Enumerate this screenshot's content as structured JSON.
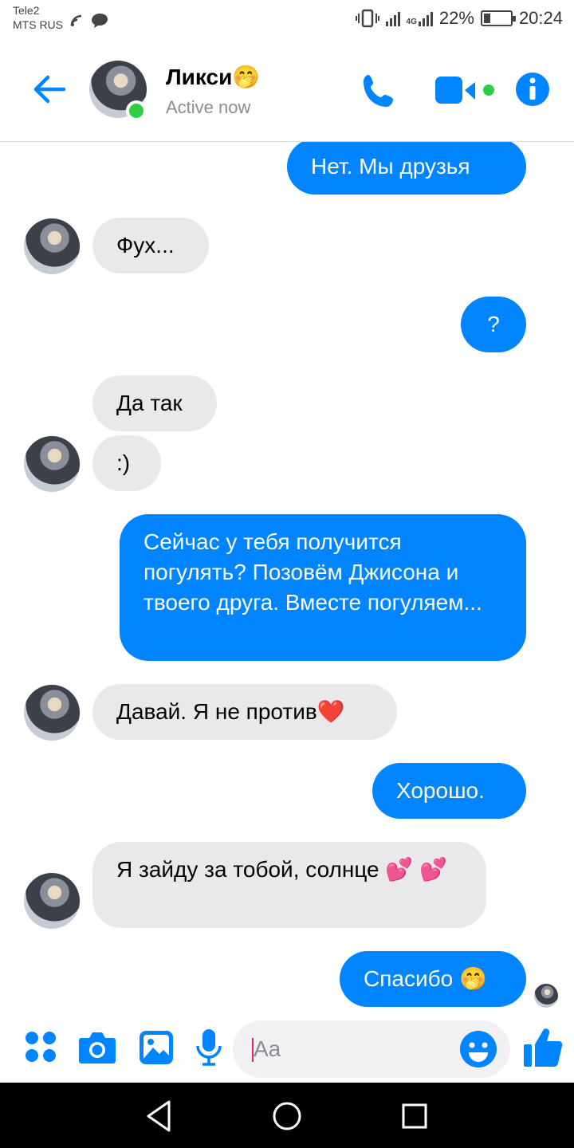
{
  "status_bar": {
    "carrier1": "Tele2",
    "carrier2": "MTS RUS",
    "network": "4G",
    "battery": "22%",
    "battery_level": 0.22,
    "time": "20:24"
  },
  "header": {
    "contact_name": "Ликси🤭",
    "status": "Active now"
  },
  "messages": [
    {
      "from": "me",
      "text": "Нет. Мы друзья"
    },
    {
      "from": "them",
      "text": "Фух..."
    },
    {
      "from": "me",
      "text": "?"
    },
    {
      "from": "them",
      "text": "Да так"
    },
    {
      "from": "them",
      "text": ":)"
    },
    {
      "from": "me",
      "text": "Сейчас у тебя получится погулять? Позовём Джисона и твоего друга. Вместе погуляем..."
    },
    {
      "from": "them",
      "text": "Давай. Я не против❤️"
    },
    {
      "from": "me",
      "text": "Хорошо."
    },
    {
      "from": "them",
      "text": "Я зайду за тобой, солнце 💕 💕"
    },
    {
      "from": "me",
      "text": "Спасибо 🤭"
    }
  ],
  "composer": {
    "placeholder": "Aa"
  },
  "colors": {
    "accent": "#0084ff",
    "online": "#31cc46",
    "incoming_bubble": "#e9e9eb"
  }
}
